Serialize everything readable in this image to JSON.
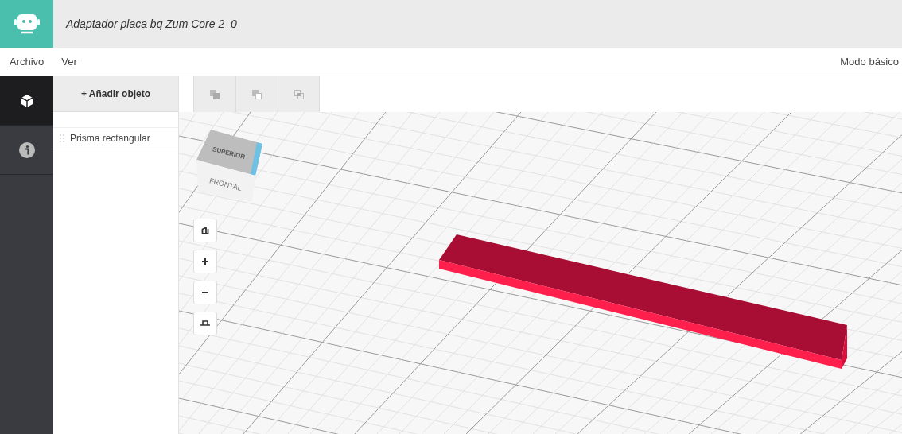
{
  "window": {
    "title": "Adaptador placa bq Zum Core 2_0"
  },
  "menu": [
    "Archivo",
    "Ver"
  ],
  "mode_link": "Modo básico",
  "sidebar_tabs": [
    {
      "selected": true
    },
    {
      "selected": false
    }
  ],
  "add_button": "+ Añadir objeto",
  "objects": [
    "Prisma rectangular"
  ],
  "view_cube": {
    "top": "SUPERIOR",
    "front": "FRONTAL"
  }
}
